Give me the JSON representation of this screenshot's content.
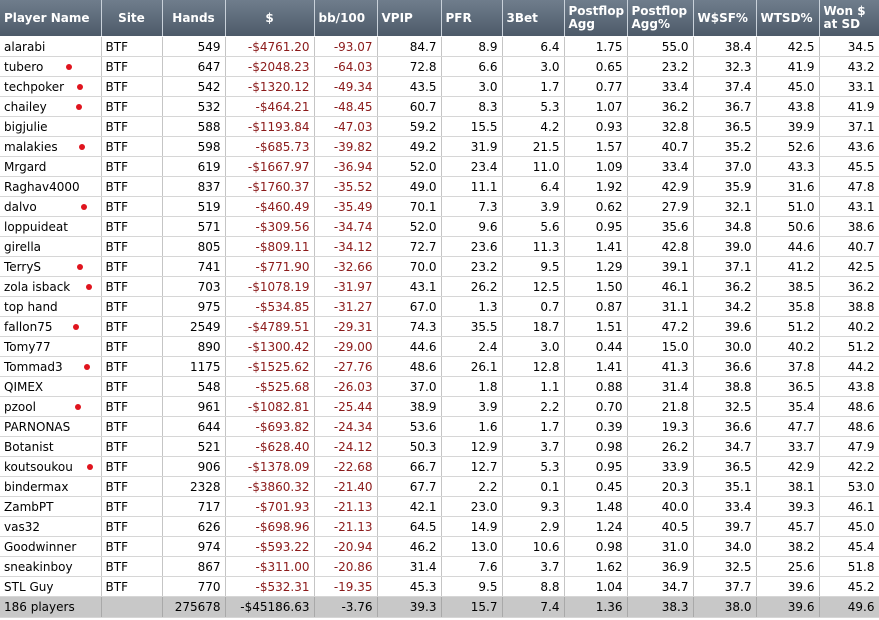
{
  "columns": [
    "Player Name",
    "Site",
    "Hands",
    "$",
    "bb/100",
    "VPIP",
    "PFR",
    "3Bet",
    "Postflop Agg",
    "Postflop Agg%",
    "W$SF%",
    "WTSD%",
    "Won $ at SD"
  ],
  "header_lines": [
    [
      "Player Name"
    ],
    [
      "Site"
    ],
    [
      "Hands"
    ],
    [
      "$"
    ],
    [
      "bb/100"
    ],
    [
      "VPIP"
    ],
    [
      "PFR"
    ],
    [
      "3Bet"
    ],
    [
      "Postflop",
      "Agg"
    ],
    [
      "Postflop",
      "Agg%"
    ],
    [
      "W$SF%"
    ],
    [
      "WTSD%"
    ],
    [
      "Won $",
      "at SD"
    ]
  ],
  "rows": [
    {
      "name": "alarabi",
      "site": "BTF",
      "hands": "549",
      "dollars": "-$4761.20",
      "bb100": "-93.07",
      "vpip": "84.7",
      "pfr": "8.9",
      "threebet": "6.4",
      "agg": "1.75",
      "aggpct": "55.0",
      "wsf": "38.4",
      "wtsd": "42.5",
      "wsd": "34.5",
      "marked": false
    },
    {
      "name": "tubero",
      "site": "BTF",
      "hands": "647",
      "dollars": "-$2048.23",
      "bb100": "-64.03",
      "vpip": "72.8",
      "pfr": "6.6",
      "threebet": "3.0",
      "agg": "0.65",
      "aggpct": "23.2",
      "wsf": "32.3",
      "wtsd": "41.9",
      "wsd": "43.2",
      "marked": true
    },
    {
      "name": "techpoker",
      "site": "BTF",
      "hands": "542",
      "dollars": "-$1320.12",
      "bb100": "-49.34",
      "vpip": "43.5",
      "pfr": "3.0",
      "threebet": "1.7",
      "agg": "0.77",
      "aggpct": "33.4",
      "wsf": "37.4",
      "wtsd": "45.0",
      "wsd": "33.1",
      "marked": true
    },
    {
      "name": "chailey",
      "site": "BTF",
      "hands": "532",
      "dollars": "-$464.21",
      "bb100": "-48.45",
      "vpip": "60.7",
      "pfr": "8.3",
      "threebet": "5.3",
      "agg": "1.07",
      "aggpct": "36.2",
      "wsf": "36.7",
      "wtsd": "43.8",
      "wsd": "41.9",
      "marked": true
    },
    {
      "name": "bigjulie",
      "site": "BTF",
      "hands": "588",
      "dollars": "-$1193.84",
      "bb100": "-47.03",
      "vpip": "59.2",
      "pfr": "15.5",
      "threebet": "4.2",
      "agg": "0.93",
      "aggpct": "32.8",
      "wsf": "36.5",
      "wtsd": "39.9",
      "wsd": "37.1",
      "marked": false
    },
    {
      "name": "malakies",
      "site": "BTF",
      "hands": "598",
      "dollars": "-$685.73",
      "bb100": "-39.82",
      "vpip": "49.2",
      "pfr": "31.9",
      "threebet": "21.5",
      "agg": "1.57",
      "aggpct": "40.7",
      "wsf": "35.2",
      "wtsd": "52.6",
      "wsd": "43.6",
      "marked": true
    },
    {
      "name": "Mrgard",
      "site": "BTF",
      "hands": "619",
      "dollars": "-$1667.97",
      "bb100": "-36.94",
      "vpip": "52.0",
      "pfr": "23.4",
      "threebet": "11.0",
      "agg": "1.09",
      "aggpct": "33.4",
      "wsf": "37.0",
      "wtsd": "43.3",
      "wsd": "45.5",
      "marked": false
    },
    {
      "name": "Raghav4000",
      "site": "BTF",
      "hands": "837",
      "dollars": "-$1760.37",
      "bb100": "-35.52",
      "vpip": "49.0",
      "pfr": "11.1",
      "threebet": "6.4",
      "agg": "1.92",
      "aggpct": "42.9",
      "wsf": "35.9",
      "wtsd": "31.6",
      "wsd": "47.8",
      "marked": false
    },
    {
      "name": "dalvo",
      "site": "BTF",
      "hands": "519",
      "dollars": "-$460.49",
      "bb100": "-35.49",
      "vpip": "70.1",
      "pfr": "7.3",
      "threebet": "3.9",
      "agg": "0.62",
      "aggpct": "27.9",
      "wsf": "32.1",
      "wtsd": "51.0",
      "wsd": "43.1",
      "marked": true
    },
    {
      "name": "loppuideat",
      "site": "BTF",
      "hands": "571",
      "dollars": "-$309.56",
      "bb100": "-34.74",
      "vpip": "52.0",
      "pfr": "9.6",
      "threebet": "5.6",
      "agg": "0.95",
      "aggpct": "35.6",
      "wsf": "34.8",
      "wtsd": "50.6",
      "wsd": "38.6",
      "marked": false
    },
    {
      "name": "girella",
      "site": "BTF",
      "hands": "805",
      "dollars": "-$809.11",
      "bb100": "-34.12",
      "vpip": "72.7",
      "pfr": "23.6",
      "threebet": "11.3",
      "agg": "1.41",
      "aggpct": "42.8",
      "wsf": "39.0",
      "wtsd": "44.6",
      "wsd": "40.7",
      "marked": false
    },
    {
      "name": "TerryS",
      "site": "BTF",
      "hands": "741",
      "dollars": "-$771.90",
      "bb100": "-32.66",
      "vpip": "70.0",
      "pfr": "23.2",
      "threebet": "9.5",
      "agg": "1.29",
      "aggpct": "39.1",
      "wsf": "37.1",
      "wtsd": "41.2",
      "wsd": "42.5",
      "marked": true
    },
    {
      "name": "zola isback",
      "site": "BTF",
      "hands": "703",
      "dollars": "-$1078.19",
      "bb100": "-31.97",
      "vpip": "43.1",
      "pfr": "26.2",
      "threebet": "12.5",
      "agg": "1.50",
      "aggpct": "46.1",
      "wsf": "36.2",
      "wtsd": "38.5",
      "wsd": "36.2",
      "marked": true
    },
    {
      "name": "top hand",
      "site": "BTF",
      "hands": "975",
      "dollars": "-$534.85",
      "bb100": "-31.27",
      "vpip": "67.0",
      "pfr": "1.3",
      "threebet": "0.7",
      "agg": "0.87",
      "aggpct": "31.1",
      "wsf": "34.2",
      "wtsd": "35.8",
      "wsd": "38.8",
      "marked": false
    },
    {
      "name": "fallon75",
      "site": "BTF",
      "hands": "2549",
      "dollars": "-$4789.51",
      "bb100": "-29.31",
      "vpip": "74.3",
      "pfr": "35.5",
      "threebet": "18.7",
      "agg": "1.51",
      "aggpct": "47.2",
      "wsf": "39.6",
      "wtsd": "51.2",
      "wsd": "40.2",
      "marked": true
    },
    {
      "name": "Tomy77",
      "site": "BTF",
      "hands": "890",
      "dollars": "-$1300.42",
      "bb100": "-29.00",
      "vpip": "44.6",
      "pfr": "2.4",
      "threebet": "3.0",
      "agg": "0.44",
      "aggpct": "15.0",
      "wsf": "30.0",
      "wtsd": "40.2",
      "wsd": "51.2",
      "marked": false
    },
    {
      "name": "Tommad3",
      "site": "BTF",
      "hands": "1175",
      "dollars": "-$1525.62",
      "bb100": "-27.76",
      "vpip": "48.6",
      "pfr": "26.1",
      "threebet": "12.8",
      "agg": "1.41",
      "aggpct": "41.3",
      "wsf": "36.6",
      "wtsd": "37.8",
      "wsd": "44.2",
      "marked": true
    },
    {
      "name": "QIMEX",
      "site": "BTF",
      "hands": "548",
      "dollars": "-$525.68",
      "bb100": "-26.03",
      "vpip": "37.0",
      "pfr": "1.8",
      "threebet": "1.1",
      "agg": "0.88",
      "aggpct": "31.4",
      "wsf": "38.8",
      "wtsd": "36.5",
      "wsd": "43.8",
      "marked": false
    },
    {
      "name": "pzool",
      "site": "BTF",
      "hands": "961",
      "dollars": "-$1082.81",
      "bb100": "-25.44",
      "vpip": "38.9",
      "pfr": "3.9",
      "threebet": "2.2",
      "agg": "0.70",
      "aggpct": "21.8",
      "wsf": "32.5",
      "wtsd": "35.4",
      "wsd": "48.6",
      "marked": true
    },
    {
      "name": "PARNONAS",
      "site": "BTF",
      "hands": "644",
      "dollars": "-$693.82",
      "bb100": "-24.34",
      "vpip": "53.6",
      "pfr": "1.6",
      "threebet": "1.7",
      "agg": "0.39",
      "aggpct": "19.3",
      "wsf": "36.6",
      "wtsd": "47.7",
      "wsd": "48.6",
      "marked": false
    },
    {
      "name": "Botanist",
      "site": "BTF",
      "hands": "521",
      "dollars": "-$628.40",
      "bb100": "-24.12",
      "vpip": "50.3",
      "pfr": "12.9",
      "threebet": "3.7",
      "agg": "0.98",
      "aggpct": "26.2",
      "wsf": "34.7",
      "wtsd": "33.7",
      "wsd": "47.9",
      "marked": false
    },
    {
      "name": "koutsoukou",
      "site": "BTF",
      "hands": "906",
      "dollars": "-$1378.09",
      "bb100": "-22.68",
      "vpip": "66.7",
      "pfr": "12.7",
      "threebet": "5.3",
      "agg": "0.95",
      "aggpct": "33.9",
      "wsf": "36.5",
      "wtsd": "42.9",
      "wsd": "42.2",
      "marked": true
    },
    {
      "name": "bindermax",
      "site": "BTF",
      "hands": "2328",
      "dollars": "-$3860.32",
      "bb100": "-21.40",
      "vpip": "67.7",
      "pfr": "2.2",
      "threebet": "0.1",
      "agg": "0.45",
      "aggpct": "20.3",
      "wsf": "35.1",
      "wtsd": "38.1",
      "wsd": "53.0",
      "marked": false
    },
    {
      "name": "ZambPT",
      "site": "BTF",
      "hands": "717",
      "dollars": "-$701.93",
      "bb100": "-21.13",
      "vpip": "42.1",
      "pfr": "23.0",
      "threebet": "9.3",
      "agg": "1.48",
      "aggpct": "40.0",
      "wsf": "33.4",
      "wtsd": "39.3",
      "wsd": "46.1",
      "marked": false
    },
    {
      "name": "vas32",
      "site": "BTF",
      "hands": "626",
      "dollars": "-$698.96",
      "bb100": "-21.13",
      "vpip": "64.5",
      "pfr": "14.9",
      "threebet": "2.9",
      "agg": "1.24",
      "aggpct": "40.5",
      "wsf": "39.7",
      "wtsd": "45.7",
      "wsd": "45.0",
      "marked": false
    },
    {
      "name": "Goodwinner",
      "site": "BTF",
      "hands": "974",
      "dollars": "-$593.22",
      "bb100": "-20.94",
      "vpip": "46.2",
      "pfr": "13.0",
      "threebet": "10.6",
      "agg": "0.98",
      "aggpct": "31.0",
      "wsf": "34.0",
      "wtsd": "38.2",
      "wsd": "45.4",
      "marked": false
    },
    {
      "name": "sneakinboy",
      "site": "BTF",
      "hands": "867",
      "dollars": "-$311.00",
      "bb100": "-20.86",
      "vpip": "31.4",
      "pfr": "7.6",
      "threebet": "3.7",
      "agg": "1.62",
      "aggpct": "36.9",
      "wsf": "32.5",
      "wtsd": "25.6",
      "wsd": "51.8",
      "marked": false
    },
    {
      "name": "STL Guy",
      "site": "BTF",
      "hands": "770",
      "dollars": "-$532.31",
      "bb100": "-19.35",
      "vpip": "45.3",
      "pfr": "9.5",
      "threebet": "8.8",
      "agg": "1.04",
      "aggpct": "34.7",
      "wsf": "37.7",
      "wtsd": "39.6",
      "wsd": "45.2",
      "marked": false
    }
  ],
  "totals": {
    "name": "186 players",
    "site": "",
    "hands": "275678",
    "dollars": "-$45186.63",
    "bb100": "-3.76",
    "vpip": "39.3",
    "pfr": "15.7",
    "threebet": "7.4",
    "agg": "1.36",
    "aggpct": "38.3",
    "wsf": "38.0",
    "wtsd": "39.6",
    "wsd": "49.6"
  },
  "colors": {
    "header_bg": "#5f6c7b",
    "negative": "#8b1a1a",
    "marker_dot": "#e0141e",
    "totals_bg": "#c8c8c8"
  }
}
